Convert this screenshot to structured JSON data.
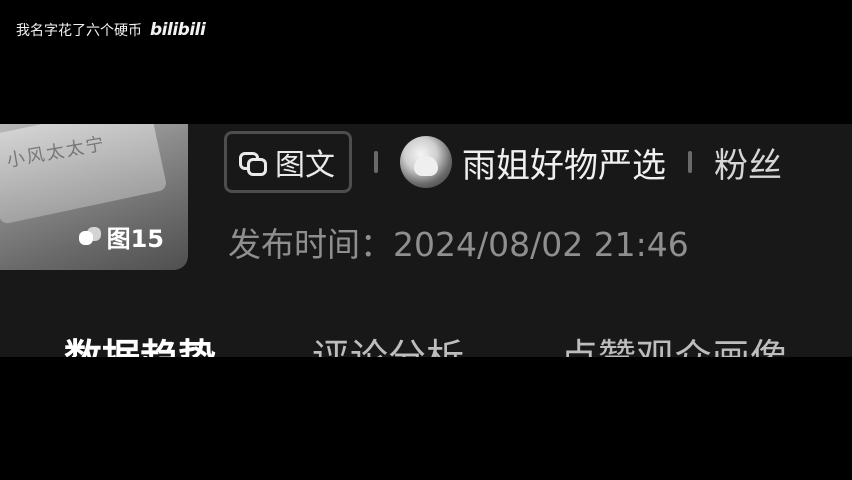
{
  "watermark": {
    "text": "我名字花了六个硬币",
    "logo": "bilibili"
  },
  "thumbnail": {
    "overlay_text": "小风太太宁",
    "count_icon": "images-icon",
    "count_label": "图15"
  },
  "post_type": {
    "icon": "image-text-icon",
    "label": "图文"
  },
  "shop": {
    "name": "雨姐好物严选"
  },
  "fans_label": "粉丝",
  "publish": {
    "label": "发布时间：",
    "value": "2024/08/02 21:46"
  },
  "tabs": [
    {
      "label": "数据趋势",
      "active": true
    },
    {
      "label": "评论分析",
      "active": false
    },
    {
      "label": "点赞观众画像",
      "active": false
    }
  ]
}
